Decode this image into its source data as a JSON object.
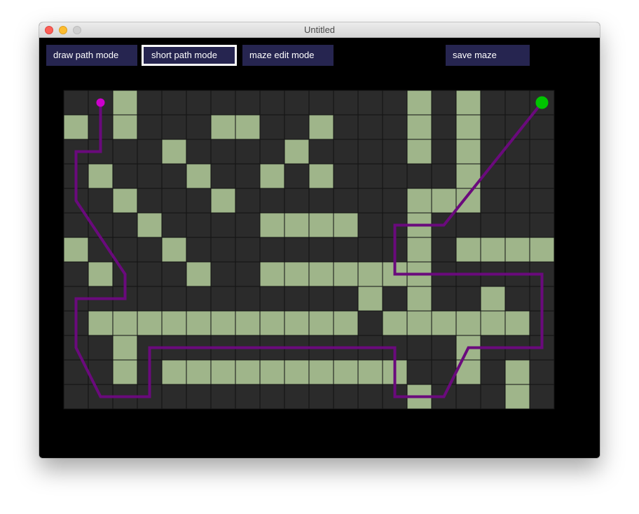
{
  "window": {
    "title": "Untitled"
  },
  "toolbar": {
    "draw_path_label": "draw path mode",
    "short_path_label": "short path mode",
    "maze_edit_label": "maze edit mode",
    "save_maze_label": "save maze",
    "active_mode": "short path mode"
  },
  "colors": {
    "wall": "#9fb58a",
    "open_cell": "#2b2b2b",
    "grid_line": "#111111",
    "path": "#6a0a7c",
    "start": "#cc00cc",
    "goal": "#00c400",
    "button_bg": "#262550"
  },
  "maze": {
    "cols": 20,
    "rows": 13,
    "walls": [
      "00100000000000101000",
      "10100011001000101000",
      "00001000010000101000",
      "01000100101000001000",
      "00100010000000111000",
      "00010000111100100000",
      "10001000000000101111",
      "01000100111111100000",
      "00000000000010100100",
      "01111111111101111110",
      "00100000000000001000",
      "00101111111111001010",
      "00000000000000100010"
    ],
    "start": {
      "col": 1.5,
      "row": 0.5
    },
    "goal": {
      "col": 19.5,
      "row": 0.5
    },
    "path": [
      [
        1.5,
        0.5
      ],
      [
        1.5,
        2.5
      ],
      [
        0.5,
        2.5
      ],
      [
        0.5,
        4.5
      ],
      [
        2.5,
        7.5
      ],
      [
        2.5,
        8.5
      ],
      [
        0.5,
        8.5
      ],
      [
        0.5,
        10.5
      ],
      [
        1.5,
        12.5
      ],
      [
        3.5,
        12.5
      ],
      [
        3.5,
        10.5
      ],
      [
        13.5,
        10.5
      ],
      [
        13.5,
        12.5
      ],
      [
        15.5,
        12.5
      ],
      [
        16.5,
        10.5
      ],
      [
        19.5,
        10.5
      ],
      [
        19.5,
        7.5
      ],
      [
        13.5,
        7.5
      ],
      [
        13.5,
        5.5
      ],
      [
        15.5,
        5.5
      ],
      [
        19.5,
        0.5
      ]
    ]
  }
}
